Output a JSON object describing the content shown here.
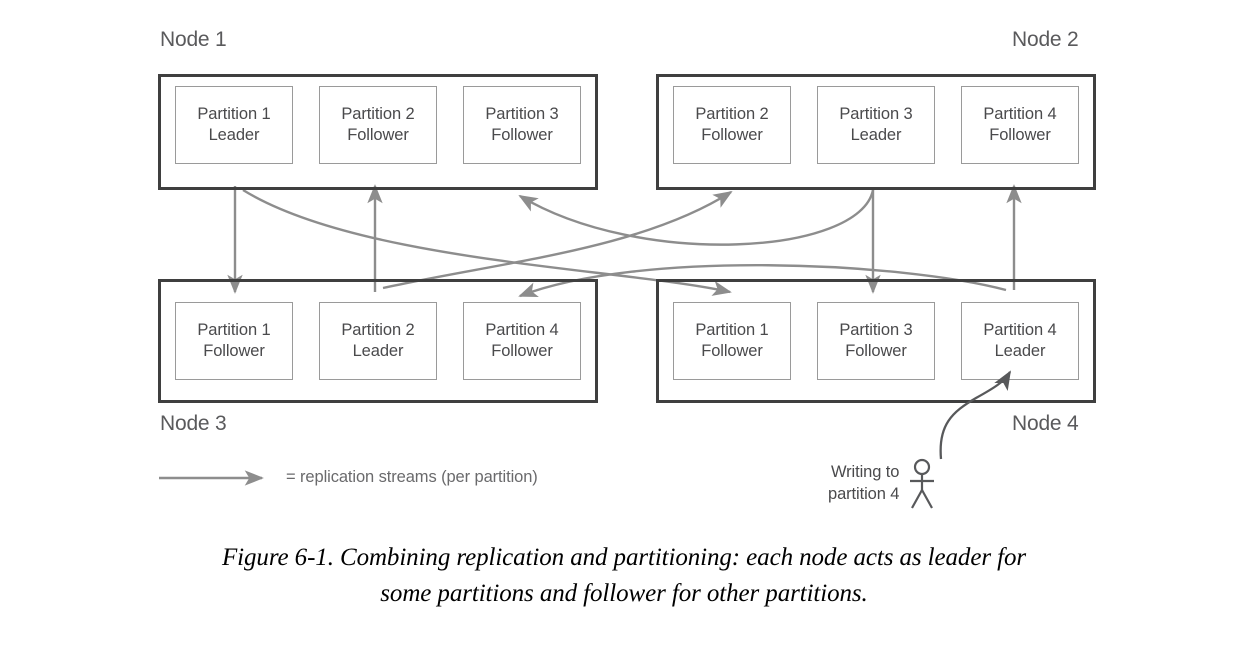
{
  "figure": {
    "caption_line1": "Figure 6-1. Combining replication and partitioning: each node acts as leader for",
    "caption_line2": "some partitions and follower for other partitions."
  },
  "nodes": [
    {
      "id": "node1",
      "label": "Node 1",
      "partitions": [
        {
          "name": "Partition 1",
          "role": "Leader"
        },
        {
          "name": "Partition 2",
          "role": "Follower"
        },
        {
          "name": "Partition 3",
          "role": "Follower"
        }
      ]
    },
    {
      "id": "node2",
      "label": "Node 2",
      "partitions": [
        {
          "name": "Partition 2",
          "role": "Follower"
        },
        {
          "name": "Partition 3",
          "role": "Leader"
        },
        {
          "name": "Partition 4",
          "role": "Follower"
        }
      ]
    },
    {
      "id": "node3",
      "label": "Node 3",
      "partitions": [
        {
          "name": "Partition 1",
          "role": "Follower"
        },
        {
          "name": "Partition 2",
          "role": "Leader"
        },
        {
          "name": "Partition 4",
          "role": "Follower"
        }
      ]
    },
    {
      "id": "node4",
      "label": "Node 4",
      "partitions": [
        {
          "name": "Partition 1",
          "role": "Follower"
        },
        {
          "name": "Partition 3",
          "role": "Follower"
        },
        {
          "name": "Partition 4",
          "role": "Leader"
        }
      ]
    }
  ],
  "legend": {
    "equals_text": "= replication streams (per partition)"
  },
  "writer": {
    "line1": "Writing to",
    "line2": "partition 4",
    "icon": "person-stick-figure-icon"
  },
  "colors": {
    "node_border": "#3f3f3f",
    "partition_border": "#9a9a9a",
    "arrow": "#8d8d8d",
    "writer_arrow": "#58595b",
    "text": "#4a4a4c",
    "caption_text": "#000000",
    "background": "#ffffff"
  }
}
